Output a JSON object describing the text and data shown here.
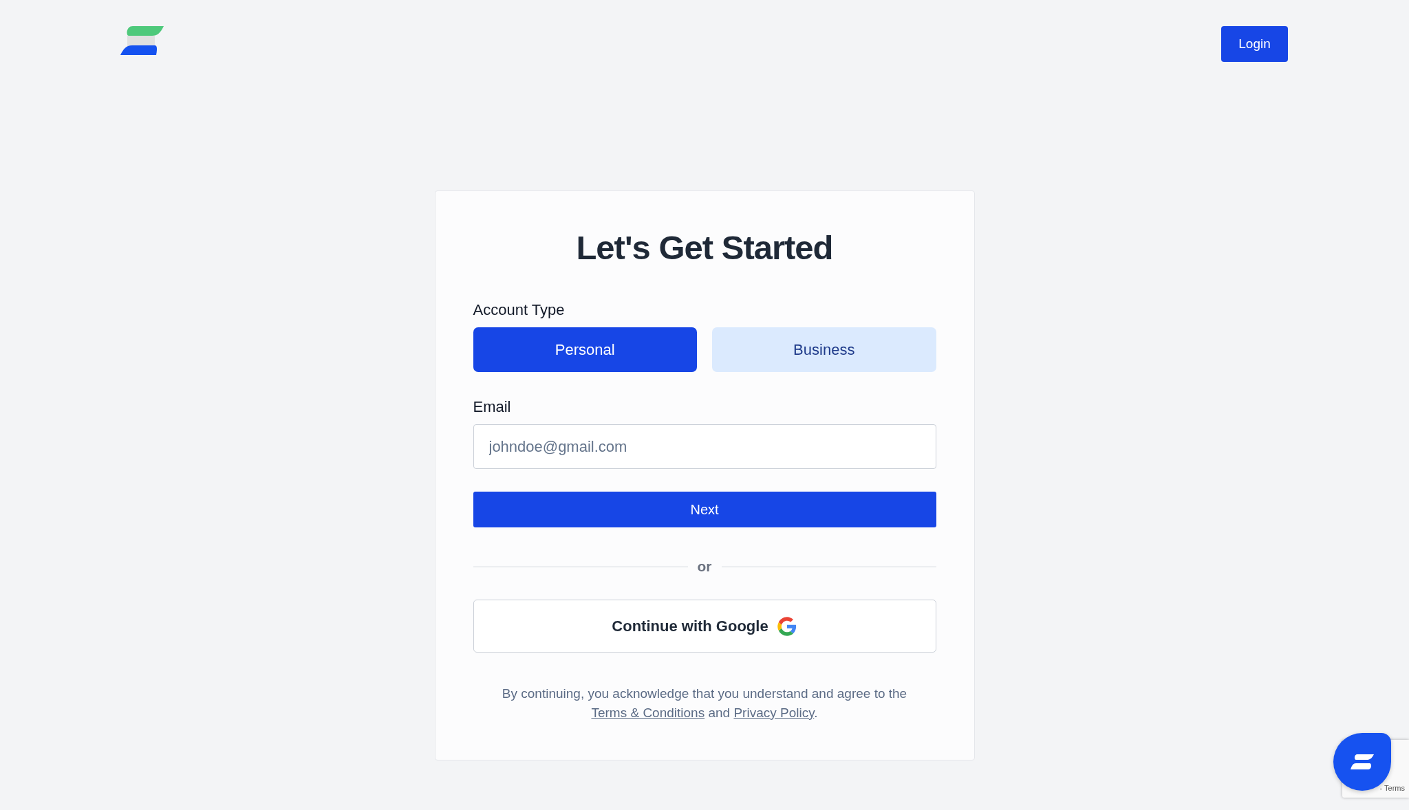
{
  "header": {
    "login_button": "Login"
  },
  "card": {
    "title": "Let's Get Started",
    "account_type": {
      "label": "Account Type",
      "options": [
        {
          "label": "Personal",
          "selected": true
        },
        {
          "label": "Business",
          "selected": false
        }
      ]
    },
    "email": {
      "label": "Email",
      "placeholder": "johndoe@gmail.com"
    },
    "next_button": "Next",
    "divider": "or",
    "google_button": "Continue with Google",
    "legal": {
      "text": "By continuing, you acknowledge that you understand and agree to the",
      "terms_link": "Terms & Conditions",
      "joiner": "and",
      "privacy_link": "Privacy Policy",
      "end": "."
    }
  },
  "recaptcha": {
    "text": "- Terms"
  }
}
